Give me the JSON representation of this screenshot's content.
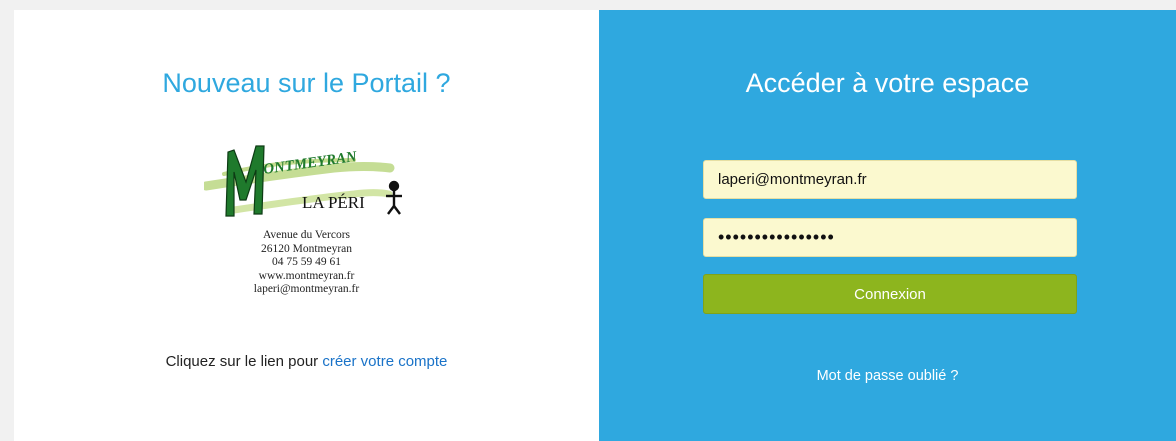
{
  "left": {
    "title": "Nouveau sur le Portail ?",
    "logo": {
      "initial": "M",
      "name_rest": "ONTMEYRAN",
      "subtitle": "LA PÉRI"
    },
    "address_lines": [
      "Avenue du Vercors",
      "26120 Montmeyran",
      "04 75 59 49 61",
      "www.montmeyran.fr",
      "laperi@montmeyran.fr"
    ],
    "signup_prefix": "Cliquez sur le lien pour ",
    "signup_link": "créer votre compte"
  },
  "right": {
    "title": "Accéder à votre espace",
    "email_value": "laperi@montmeyran.fr",
    "password_value": "••••••••••••••••",
    "login_button": "Connexion",
    "forgot_link": "Mot de passe oublié ?"
  },
  "colors": {
    "accent_blue": "#2fa8df",
    "button_green": "#8db51e",
    "input_bg": "#fbf9cf",
    "link_blue": "#1a73c8"
  }
}
